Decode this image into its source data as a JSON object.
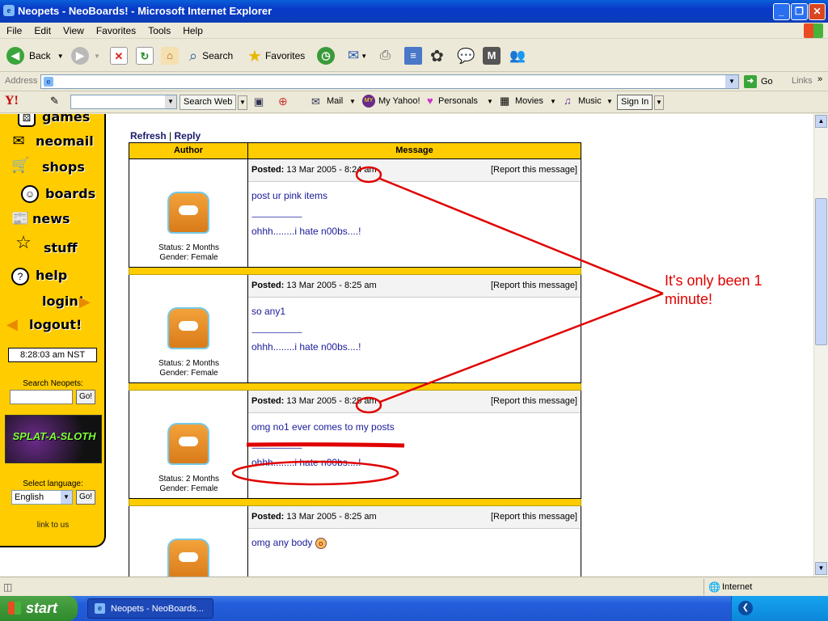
{
  "window": {
    "title": "Neopets - NeoBoards! - Microsoft Internet Explorer",
    "logo_char": "e",
    "min_char": "_",
    "max_char": "❐",
    "close_char": "✕"
  },
  "menu": [
    "File",
    "Edit",
    "View",
    "Favorites",
    "Tools",
    "Help"
  ],
  "toolbar": {
    "back": "Back",
    "search": "Search",
    "favorites": "Favorites"
  },
  "address": {
    "label": "Address",
    "value": "",
    "go": "Go",
    "links": "Links"
  },
  "yahoo": {
    "logo": "Y!",
    "search_web": "Search Web",
    "mail": "Mail",
    "my_yahoo": "My Yahoo!",
    "personals": "Personals",
    "movies": "Movies",
    "music": "Music",
    "sign_in": "Sign In"
  },
  "sidebar": {
    "nav": [
      "games",
      "neomail",
      "shops",
      "boards",
      "news",
      "stuff",
      "help",
      "login!",
      "logout!"
    ],
    "clock": "8:28:03 am NST",
    "search_label": "Search Neopets:",
    "go": "Go!",
    "banner": "SPLAT-A-SLOTH",
    "select_language": "Select language:",
    "language": "English",
    "link_to_us": "link to us"
  },
  "board": {
    "refresh": "Refresh",
    "separator": "|",
    "reply": "Reply",
    "col_author": "Author",
    "col_message": "Message",
    "posted_label": "Posted:",
    "report": "[Report this message]",
    "signature": "ohhh........i hate n00bs....!",
    "sig_line": "-------------------------------",
    "posts": [
      {
        "date": "13 Mar 2005 - 8:24 am",
        "text": "post ur pink items",
        "status": "Status: 2 Months",
        "gender": "Gender: Female"
      },
      {
        "date": "13 Mar 2005 - 8:25 am",
        "text": "so any1",
        "status": "Status: 2 Months",
        "gender": "Gender: Female"
      },
      {
        "date": "13 Mar 2005 - 8:25 am",
        "text": "omg no1 ever comes to my posts",
        "status": "Status: 2 Months",
        "gender": "Gender: Female"
      },
      {
        "date": "13 Mar 2005 - 8:25 am",
        "text": "omg any body",
        "status": "",
        "gender": ""
      }
    ]
  },
  "annotation": {
    "line1": "It's only been 1",
    "line2": "minute!",
    "color": "#e00000"
  },
  "status": {
    "zone": "Internet"
  },
  "taskbar": {
    "start": "start",
    "item": "Neopets - NeoBoards..."
  }
}
